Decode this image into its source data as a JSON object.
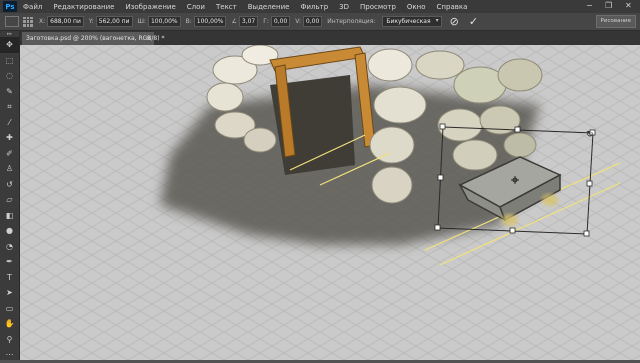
{
  "app": {
    "logo": "Ps"
  },
  "menu": [
    "Файл",
    "Редактирование",
    "Изображение",
    "Слои",
    "Текст",
    "Выделение",
    "Фильтр",
    "3D",
    "Просмотр",
    "Окно",
    "Справка"
  ],
  "window_controls": {
    "minimize": "−",
    "restore": "❐",
    "close": "✕"
  },
  "options": {
    "x_label": "X:",
    "x_value": "688,00 пи",
    "y_label": "Y:",
    "y_value": "562,00 пи",
    "w_label": "Ш:",
    "w_value": "100,00%",
    "h_label": "В:",
    "h_value": "100,00%",
    "angle_label": "∠",
    "angle_value": "3,07",
    "hskew_label": "Г:",
    "hskew_value": "0,00",
    "vskew_label": "V:",
    "vskew_value": "0,00",
    "interp_label": "Интерполяция:",
    "interp_value": "Бикубическая",
    "cancel_icon": "⊘",
    "commit_icon": "✓",
    "workspace": "Рисование"
  },
  "document_tab": {
    "title": "Заготовка.psd @ 200% (вагонетка, RGB/8) *",
    "close": "×"
  },
  "tools": [
    "selection-move",
    "artboard",
    "lasso",
    "quick-select",
    "crop",
    "eyedropper",
    "healing",
    "brush",
    "clone-stamp",
    "history-brush",
    "eraser",
    "paint-bucket",
    "blur",
    "dodge",
    "pen",
    "type",
    "path-select",
    "rectangle",
    "hand",
    "zoom",
    "edit-toolbar",
    "color-swatches"
  ],
  "colors": {
    "canvas_bg": "#c9c9c9",
    "grid_line": "#bababa",
    "transform_box": "#2a2a2a",
    "guide_yellow": "#f3e27a",
    "beam_wood": "#c98a35",
    "stone": "#e9e6db",
    "shadow": "#5a5852"
  }
}
